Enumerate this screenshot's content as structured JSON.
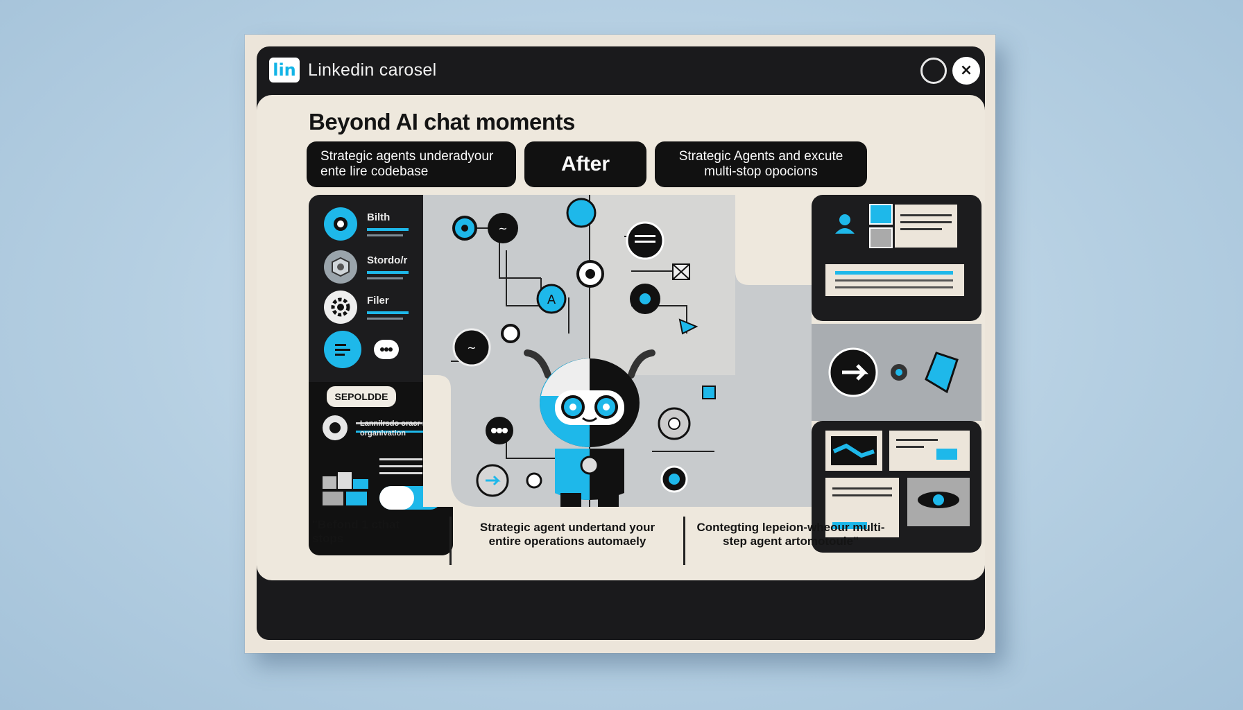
{
  "window": {
    "logo_text": "lin",
    "title": "Linkedin carosel",
    "close_glyph": "×"
  },
  "slide": {
    "heading": "Beyond AI chat moments",
    "pills": {
      "left": "Strategic agents underadyour ente lire codebase",
      "center": "After",
      "right": "Strategic Agents and excute multi-stop opocions"
    }
  },
  "sidebar": {
    "items": [
      {
        "label": "Bilth",
        "icon": "target-icon"
      },
      {
        "label": "Stordo/r",
        "icon": "shield-icon"
      },
      {
        "label": "Filer",
        "icon": "gear-icon"
      },
      {
        "label": "",
        "icon": "menu-icon"
      }
    ],
    "badge": "SEPOLDDE",
    "lower_text": "Lannilrsdo oracr nuind organivation"
  },
  "captions": {
    "left": "\"Befond 1 cthat stops",
    "center": "Strategic agent undertand your entire operations automaely",
    "right": "Contegting lepeion-wheour multi-step agent artomotoule\""
  },
  "colors": {
    "accent": "#1eb8ea",
    "dark": "#1a1a1c",
    "paper": "#eee8dd"
  }
}
